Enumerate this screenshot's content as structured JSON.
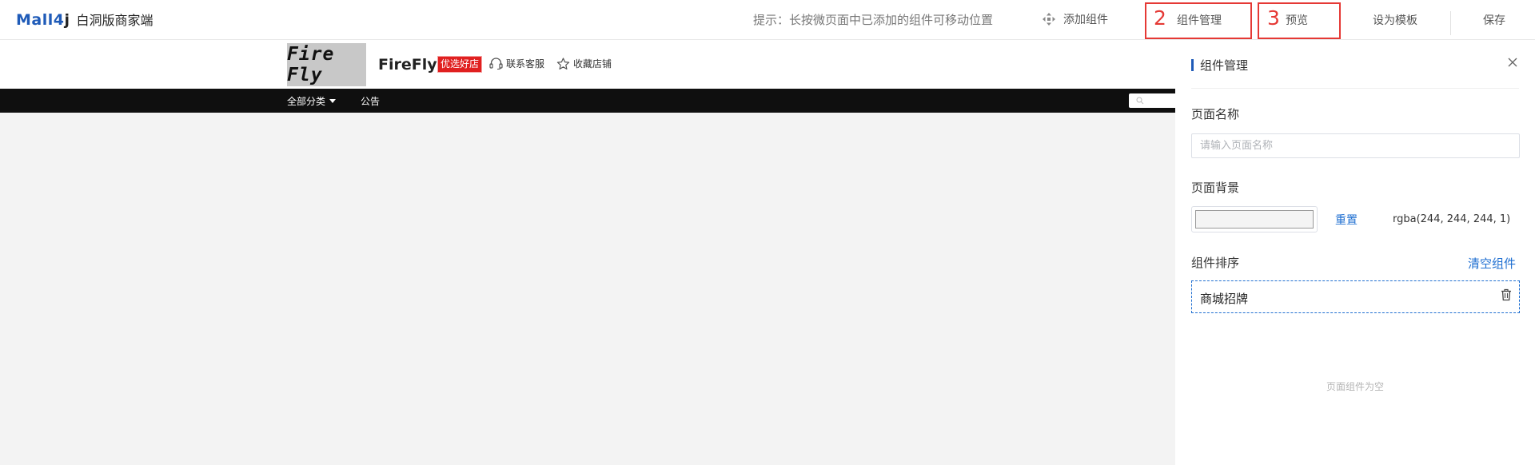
{
  "header": {
    "logo_prefix": "Mall",
    "logo_digit": "4",
    "logo_suffix": "j",
    "app_name": "白洞版商家端",
    "hint": "提示：长按微页面中已添加的组件可移动位置",
    "add_component": "添加组件",
    "component_manage": "组件管理",
    "preview": "预览",
    "set_template": "设为模板",
    "save": "保存",
    "annotation_2": "2",
    "annotation_3": "3"
  },
  "shop": {
    "logo_text": "Fire Fly",
    "name": "FireFly",
    "badge": "优选好店",
    "contact": "联系客服",
    "favorite": "收藏店铺",
    "nav": {
      "all_categories": "全部分类",
      "notice": "公告"
    }
  },
  "panel": {
    "title": "组件管理",
    "page_name_label": "页面名称",
    "page_name_placeholder": "请输入页面名称",
    "page_name_value": "",
    "page_bg_label": "页面背景",
    "reset": "重置",
    "bg_value": "rgba(244, 244, 244, 1)",
    "sort_label": "组件排序",
    "clear": "清空组件",
    "components": [
      {
        "label": "商城招牌"
      }
    ],
    "empty_text": "页面组件为空"
  },
  "colors": {
    "brand_blue": "#1f5bb8",
    "link_blue": "#1f6fd1",
    "highlight_red": "#e53935",
    "nav_bg": "#0f0f0f",
    "canvas_bg": "#f3f3f3",
    "badge_red": "#e02020",
    "page_bg_swatch": "#f4f4f4"
  },
  "icons": {
    "add_component": "move-arrows-icon",
    "contact": "headset-icon",
    "favorite": "star-icon",
    "search": "search-icon",
    "close": "close-icon",
    "delete": "trash-icon"
  }
}
